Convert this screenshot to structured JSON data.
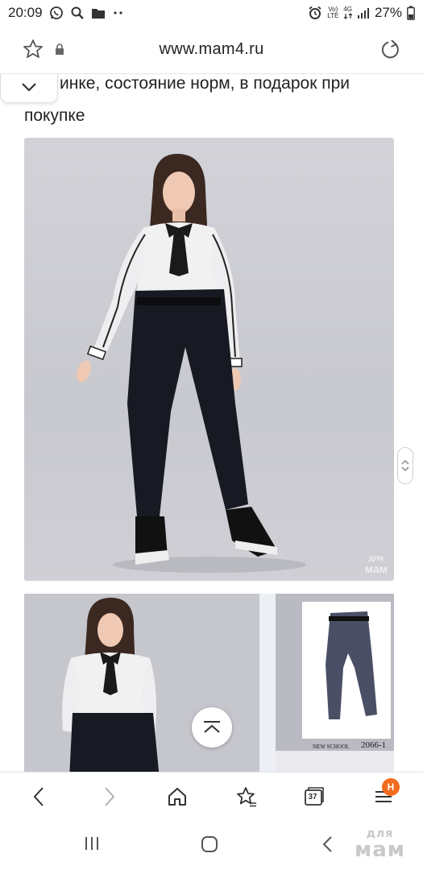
{
  "status_bar": {
    "time": "20:09",
    "volte_label_top": "Vo)",
    "volte_label_bottom": "LTE",
    "network_label_top": "4G",
    "battery_percent": "27%"
  },
  "address_bar": {
    "url": "www.mam4.ru"
  },
  "post": {
    "text_line1": "инке, состояние норм, в подарок при",
    "text_line2": "покупке"
  },
  "photo1": {
    "watermark_small": "для",
    "watermark_big": "мам"
  },
  "catalog": {
    "brand": "NEW SCHOOL",
    "code": "2066-1"
  },
  "browser_nav": {
    "tabs_count": "37",
    "menu_badge": "H"
  },
  "system_watermark": {
    "small": "для",
    "big": "мам"
  },
  "colors": {
    "accent_badge": "#f26b1d",
    "photo_bg": "#cbcbd1"
  }
}
